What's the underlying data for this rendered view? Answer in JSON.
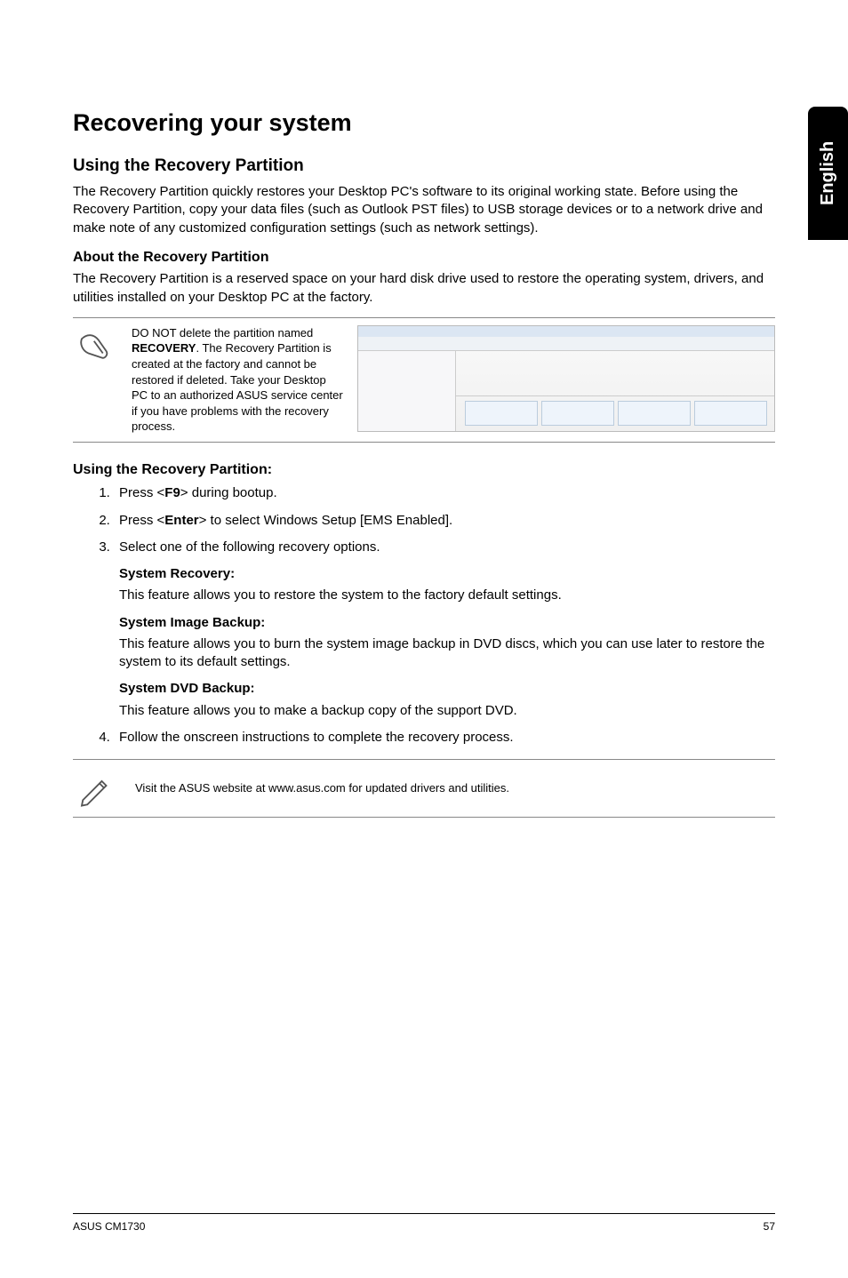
{
  "side_tab": "English",
  "h1": "Recovering your system",
  "h2_a": "Using the Recovery Partition",
  "p_intro": "The Recovery Partition quickly restores your Desktop PC's software to its original working state. Before using the Recovery Partition, copy your data files (such as Outlook PST files) to USB storage devices or to a network drive and make note of any customized configuration settings (such as network settings).",
  "h3_about": "About the Recovery Partition",
  "p_about": "The Recovery Partition is a reserved space on your hard disk drive used to restore the operating system, drivers, and utilities installed on your Desktop PC at the factory.",
  "note": {
    "prefix": "DO NOT delete the partition named ",
    "bold": "RECOVERY",
    "suffix": ". The Recovery Partition is created at the factory and cannot be restored if deleted. Take your Desktop PC to an authorized ASUS service center if you have problems with the recovery process."
  },
  "using_heading": "Using the Recovery Partition:",
  "steps": {
    "s1_a": "Press <",
    "s1_b": "F9",
    "s1_c": "> during bootup.",
    "s2_a": "Press <",
    "s2_b": "Enter",
    "s2_c": "> to select Windows Setup [EMS Enabled].",
    "s3": "Select one of the following recovery options.",
    "s4": "Follow the onscreen instructions to complete the recovery process."
  },
  "options": {
    "o1_h": "System Recovery:",
    "o1_t": "This feature allows you to restore the system to the factory default settings.",
    "o2_h": "System Image Backup:",
    "o2_t": "This feature allows you to burn the system image backup in DVD discs, which you can use later to restore the system to its default settings.",
    "o3_h": "System DVD Backup:",
    "o3_t": "This feature allows you to make a backup copy of the support DVD."
  },
  "tip": "Visit the ASUS website at www.asus.com for updated drivers and utilities.",
  "footer_left": "ASUS CM1730",
  "footer_right": "57"
}
